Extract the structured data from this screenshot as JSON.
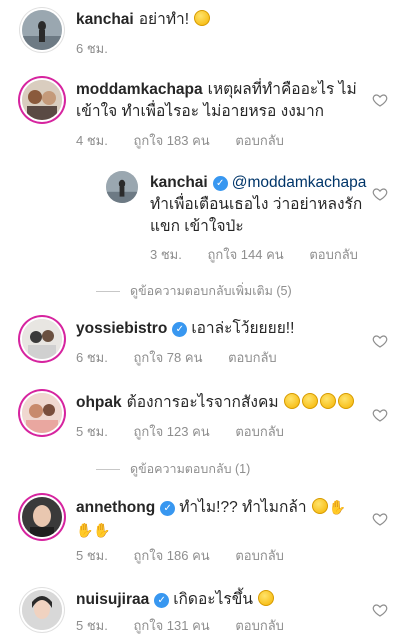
{
  "comments": [
    {
      "username": "kanchai",
      "text": "อย่าทำ!",
      "emoji": "grimace-emoji",
      "time": "6 ชม.",
      "likes": "",
      "reply_label": ""
    },
    {
      "username": "moddamkachapa",
      "text": "เหตุผลที่ทำคืออะไร ไม่เข้าใจ ทำเพื่อไรอะ ไม่อายหรอ งงมาก",
      "time": "4 ชม.",
      "likes": "ถูกใจ 183 คน",
      "reply_label": "ตอบกลับ"
    },
    {
      "username": "kanchai",
      "mention": "@moddamkachapa",
      "text": "ทำเพื่อเตือนเธอไง ว่าอย่าหลงรักแขก เข้าใจป่ะ",
      "time": "3 ชม.",
      "likes": "ถูกใจ 144 คน",
      "reply_label": "ตอบกลับ"
    },
    {
      "username": "yossiebistro",
      "text": "เอาล่ะโว้ยยยย!!",
      "time": "6 ชม.",
      "likes": "ถูกใจ 78 คน",
      "reply_label": "ตอบกลับ"
    },
    {
      "username": "ohpak",
      "text": "ต้องการอะไรจากสังคม",
      "time": "5 ชม.",
      "likes": "ถูกใจ 123 คน",
      "reply_label": "ตอบกลับ"
    },
    {
      "username": "annethong",
      "text": "ทำไม!?? ทำไมกล้า",
      "time": "5 ชม.",
      "likes": "ถูกใจ 186 คน",
      "reply_label": "ตอบกลับ"
    },
    {
      "username": "nuisujiraa",
      "text": "เกิดอะไรขึ้น",
      "time": "5 ชม.",
      "likes": "ถูกใจ 131 คน",
      "reply_label": "ตอบกลับ"
    }
  ],
  "view_more_replies_1": "ดูข้อความตอบกลับเพิ่มเติม (5)",
  "view_more_replies_2": "ดูข้อความตอบกลับ (1)",
  "colors": {
    "verified": "#3897f0",
    "mention": "#003569",
    "meta": "#8e8e8e"
  }
}
